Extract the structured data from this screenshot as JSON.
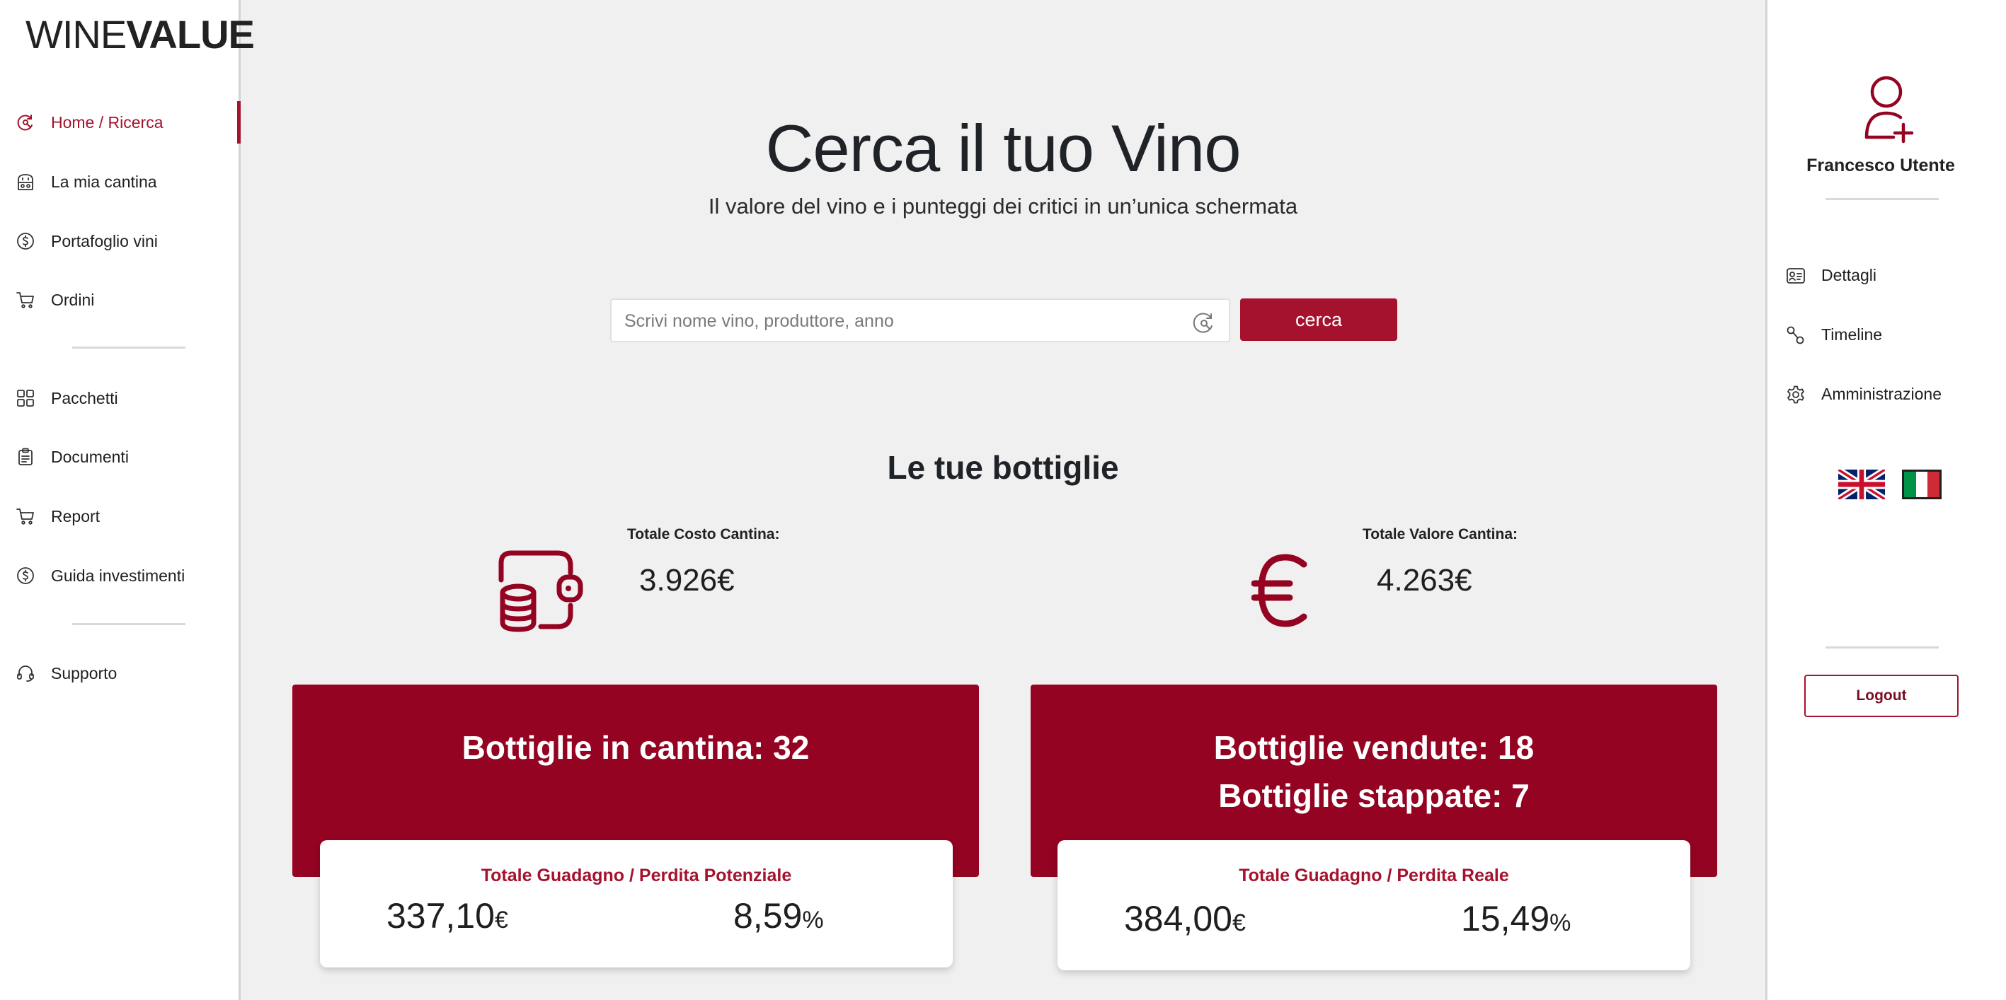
{
  "app": {
    "logo_thin": "WINE",
    "logo_bold": "VALUE"
  },
  "colors": {
    "accent": "#a5122e",
    "card_bg": "#940321",
    "page_bg": "#f0f0f0"
  },
  "sidebar": {
    "items": [
      {
        "label": "Home / Ricerca",
        "icon": "search-refresh-icon",
        "active": true
      },
      {
        "label": "La mia cantina",
        "icon": "cellar-icon"
      },
      {
        "label": "Portafoglio vini",
        "icon": "dollar-coin-icon"
      },
      {
        "label": "Ordini",
        "icon": "cart-icon"
      },
      {
        "label": "Pacchetti",
        "icon": "grid-icon"
      },
      {
        "label": "Documenti",
        "icon": "clipboard-icon"
      },
      {
        "label": "Report",
        "icon": "cart-icon"
      },
      {
        "label": "Guida investimenti",
        "icon": "dollar-coin-icon"
      },
      {
        "label": "Supporto",
        "icon": "headset-icon"
      }
    ]
  },
  "hero": {
    "title": "Cerca il tuo Vino",
    "subtitle": "Il valore del vino e i punteggi dei critici in un’unica schermata"
  },
  "search": {
    "placeholder": "Scrivi nome vino, produttore, anno",
    "value": "",
    "button_label": "cerca"
  },
  "bottles": {
    "section_title": "Le tue bottiglie",
    "cost_label": "Totale Costo Cantina:",
    "cost_value": "3.926€",
    "value_label": "Totale Valore Cantina:",
    "value_value": "4.263€"
  },
  "cards": {
    "left": {
      "line1": "Bottiglie in cantina: 32",
      "sub_title": "Totale Guadagno / Perdita Potenziale",
      "amount": "337,10",
      "amount_unit": "€",
      "percent": "8,59",
      "percent_unit": "%"
    },
    "right": {
      "line1": "Bottiglie vendute: 18",
      "line2": "Bottiglie stappate: 7",
      "sub_title": "Totale Guadagno / Perdita Reale",
      "amount": "384,00",
      "amount_unit": "€",
      "percent": "15,49",
      "percent_unit": "%"
    }
  },
  "user": {
    "name": "Francesco Utente",
    "menu": [
      {
        "label": "Dettagli",
        "icon": "id-card-icon"
      },
      {
        "label": "Timeline",
        "icon": "timeline-icon"
      },
      {
        "label": "Amministrazione",
        "icon": "gear-icon"
      }
    ],
    "languages": [
      "uk-flag-icon",
      "italy-flag-icon"
    ],
    "logout_label": "Logout"
  }
}
